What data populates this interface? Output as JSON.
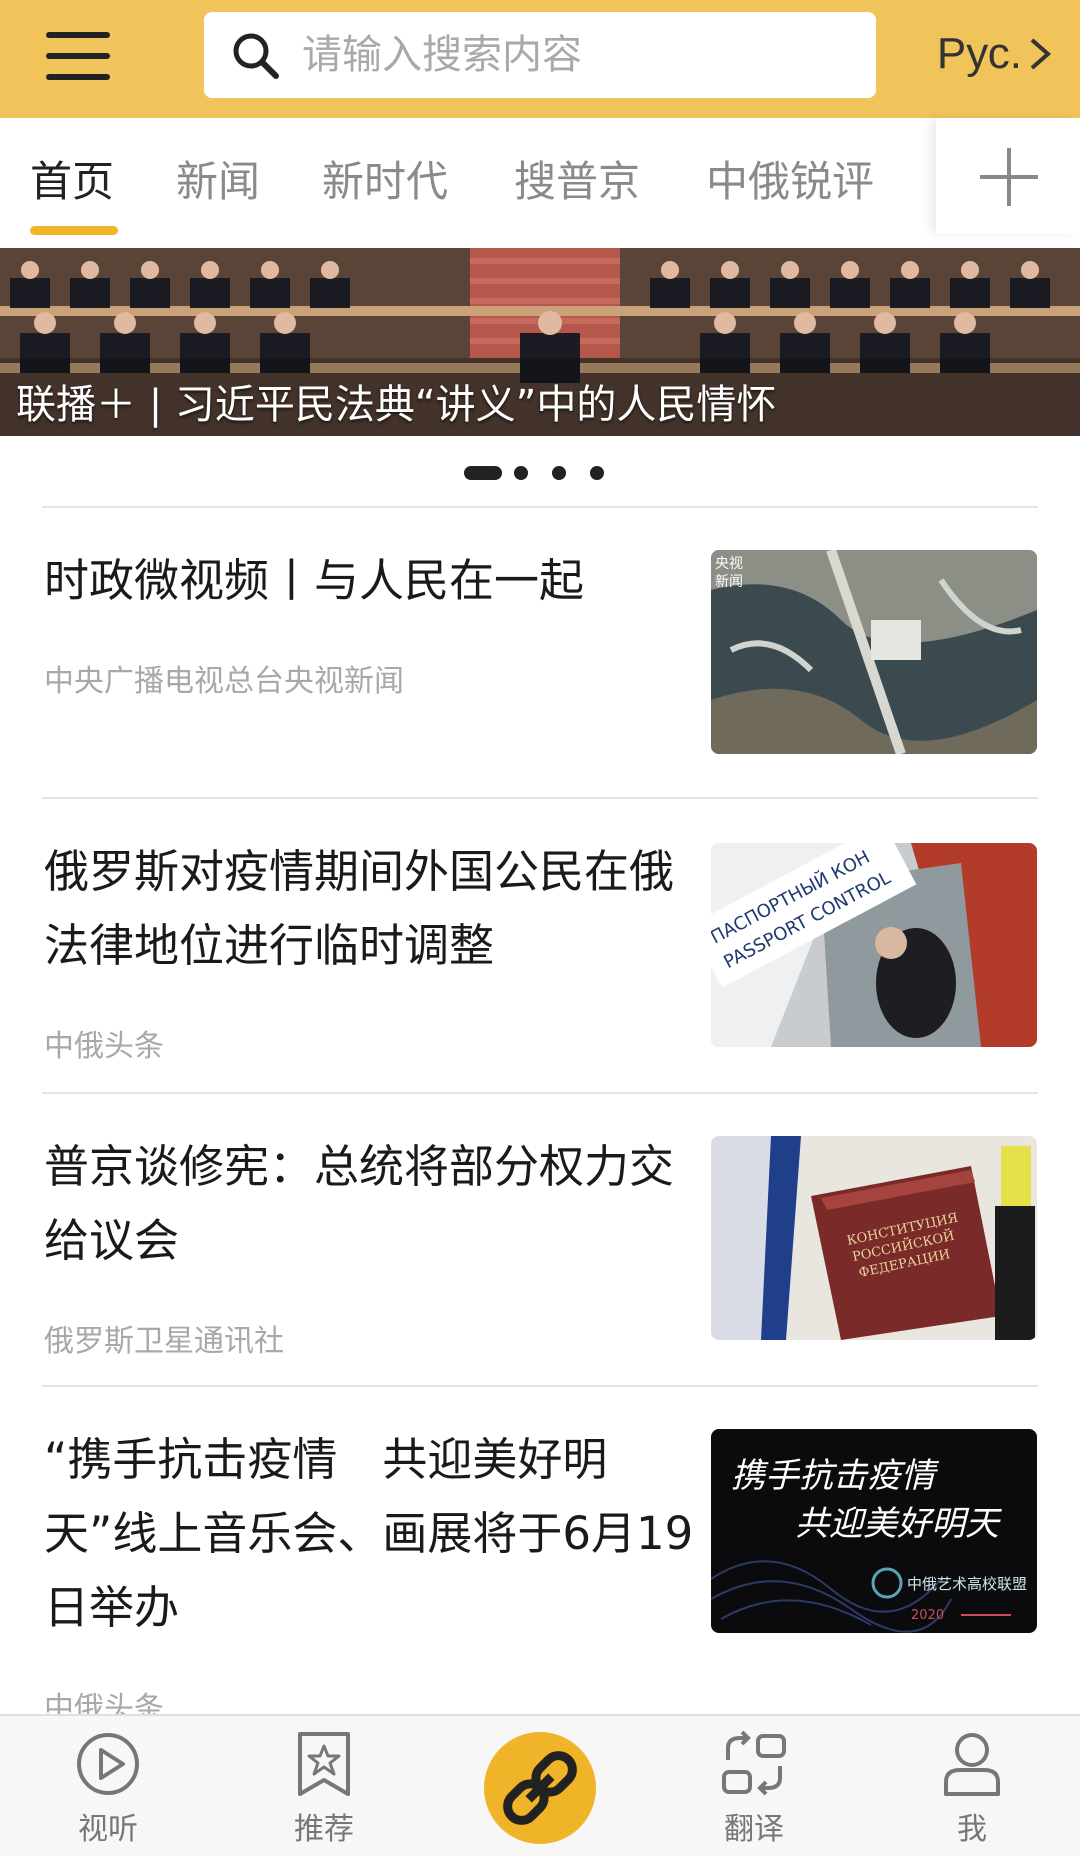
{
  "header": {
    "search_placeholder": "请输入搜索内容",
    "language_label": "Рус.",
    "accent_color": "#f0c35b"
  },
  "tabs": [
    {
      "label": "首页",
      "active": true
    },
    {
      "label": "新闻"
    },
    {
      "label": "新时代"
    },
    {
      "label": "搜普京"
    },
    {
      "label": "中俄锐评"
    }
  ],
  "banner": {
    "caption": "联播＋ | 习近平民法典“讲义”中的人民情怀",
    "slide_count": 4,
    "active_slide": 1
  },
  "news": [
    {
      "title": "时政微视频丨与人民在一起",
      "source": "中央广播电视总台央视新闻",
      "thumb_badge": [
        "央视",
        "新闻"
      ]
    },
    {
      "title": "俄罗斯对疫情期间外国公民在俄法律地位进行临时调整",
      "source": "中俄头条",
      "thumb_text": [
        "ПАСПОРТНЫЙ КОН",
        "PASSPORT CONTROL"
      ]
    },
    {
      "title": "普京谈修宪：总统将部分权力交给议会",
      "source": "俄罗斯卫星通讯社",
      "thumb_text": [
        "КОНСТИТУЦИЯ",
        "РОССИЙСКОЙ",
        "ФЕДЕРАЦИИ"
      ]
    },
    {
      "title": "“携手抗击疫情　共迎美好明天”线上音乐会、画展将于6月19日举办",
      "source": "中俄头条",
      "thumb_text": [
        "携手抗击疫情",
        "共迎美好明天",
        "中俄艺术高校联盟",
        "2020"
      ]
    }
  ],
  "bottom_nav": [
    {
      "label": "视听",
      "icon": "play-icon"
    },
    {
      "label": "推荐",
      "icon": "bookmark-star-icon"
    },
    {
      "label": "",
      "icon": "link-icon"
    },
    {
      "label": "翻译",
      "icon": "scan-translate-icon"
    },
    {
      "label": "我",
      "icon": "user-icon"
    }
  ]
}
